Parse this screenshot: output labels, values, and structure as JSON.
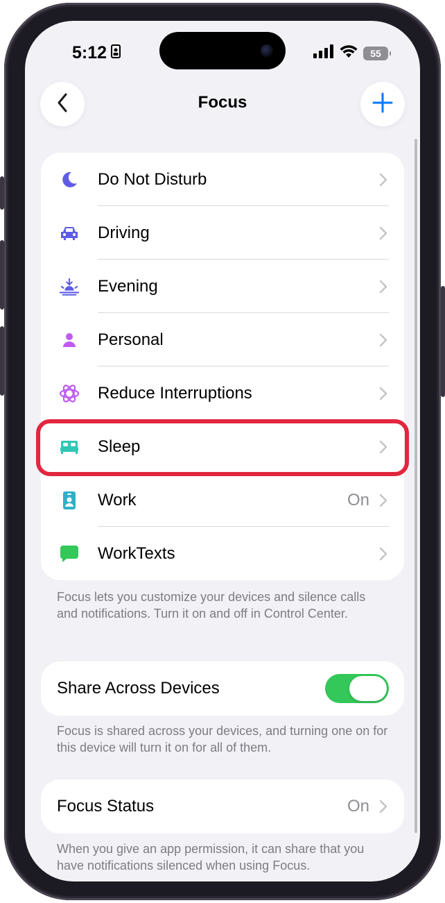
{
  "status_bar": {
    "time": "5:12",
    "battery": "55"
  },
  "nav": {
    "title": "Focus"
  },
  "focus_items": [
    {
      "label": "Do Not Disturb",
      "value": "",
      "icon": "moon-icon",
      "color": "#5e5ce6"
    },
    {
      "label": "Driving",
      "value": "",
      "icon": "car-icon",
      "color": "#5e5ce6"
    },
    {
      "label": "Evening",
      "value": "",
      "icon": "sunset-icon",
      "color": "#5e5ce6"
    },
    {
      "label": "Personal",
      "value": "",
      "icon": "person-icon",
      "color": "#bf5af2"
    },
    {
      "label": "Reduce Interruptions",
      "value": "",
      "icon": "atom-icon",
      "color": "#bf5af2"
    },
    {
      "label": "Sleep",
      "value": "",
      "icon": "bed-icon",
      "color": "#30c7b5"
    },
    {
      "label": "Work",
      "value": "On",
      "icon": "id-badge-icon",
      "color": "#30b0c7"
    },
    {
      "label": "WorkTexts",
      "value": "",
      "icon": "message-icon",
      "color": "#34c759"
    }
  ],
  "focus_note": "Focus lets you customize your devices and silence calls and notifications. Turn it on and off in Control Center.",
  "share": {
    "label": "Share Across Devices",
    "toggle_on": true,
    "note": "Focus is shared across your devices, and turning one on for this device will turn it on for all of them."
  },
  "focus_status": {
    "label": "Focus Status",
    "value": "On",
    "note": "When you give an app permission, it can share that you have notifications silenced when using Focus."
  },
  "colors": {
    "accent": "#007aff",
    "highlight": "#e2263f",
    "toggle_on": "#34c759"
  }
}
